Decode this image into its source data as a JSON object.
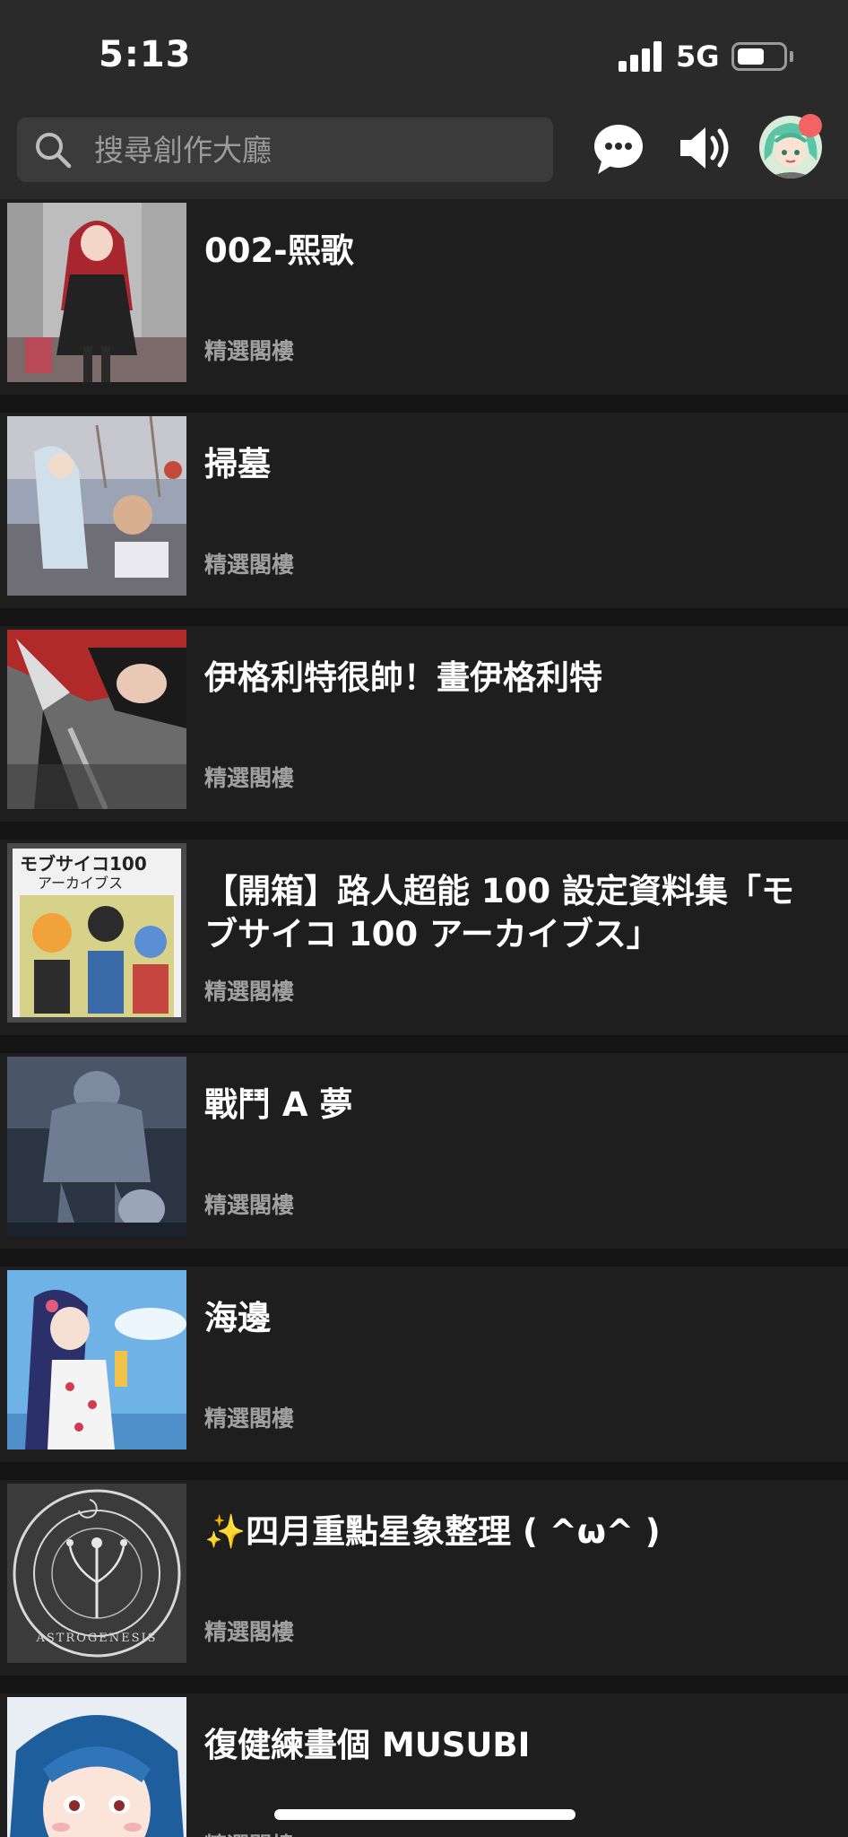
{
  "status_bar": {
    "time": "5:13",
    "network": "5G",
    "battery_level": 0.6
  },
  "header": {
    "search_placeholder": "搜尋創作大廳",
    "icons": [
      "search-icon",
      "chat-icon",
      "speaker-icon",
      "avatar"
    ],
    "notification_dot_color": "#f26363"
  },
  "posts": [
    {
      "title": "002-熙歌",
      "category": "精選閣樓"
    },
    {
      "title": "掃墓",
      "category": "精選閣樓"
    },
    {
      "title": "伊格利特很帥！畫伊格利特",
      "category": "精選閣樓"
    },
    {
      "title": "【開箱】路人超能 100 設定資料集「モブサイコ 100 アーカイブス」",
      "category": "精選閣樓"
    },
    {
      "title": "戰鬥 A 夢",
      "category": "精選閣樓"
    },
    {
      "title": "海邊",
      "category": "精選閣樓"
    },
    {
      "title": "✨四月重點星象整理 ( ^ω^ )",
      "category": "精選閣樓"
    },
    {
      "title": "復健練畫個 MUSUBI",
      "category": "精選閣樓"
    }
  ],
  "thumb_texts": {
    "mob_cover": "モブサイコ100",
    "mob_cover_sub": "アーカイブス",
    "astro": "ASTROGENESIS"
  },
  "colors": {
    "background": "#141414",
    "bar": "#2a2a2a",
    "card": "#1e1e1e",
    "search_field": "#3b3b3b",
    "subtext": "#a0a0a0"
  }
}
